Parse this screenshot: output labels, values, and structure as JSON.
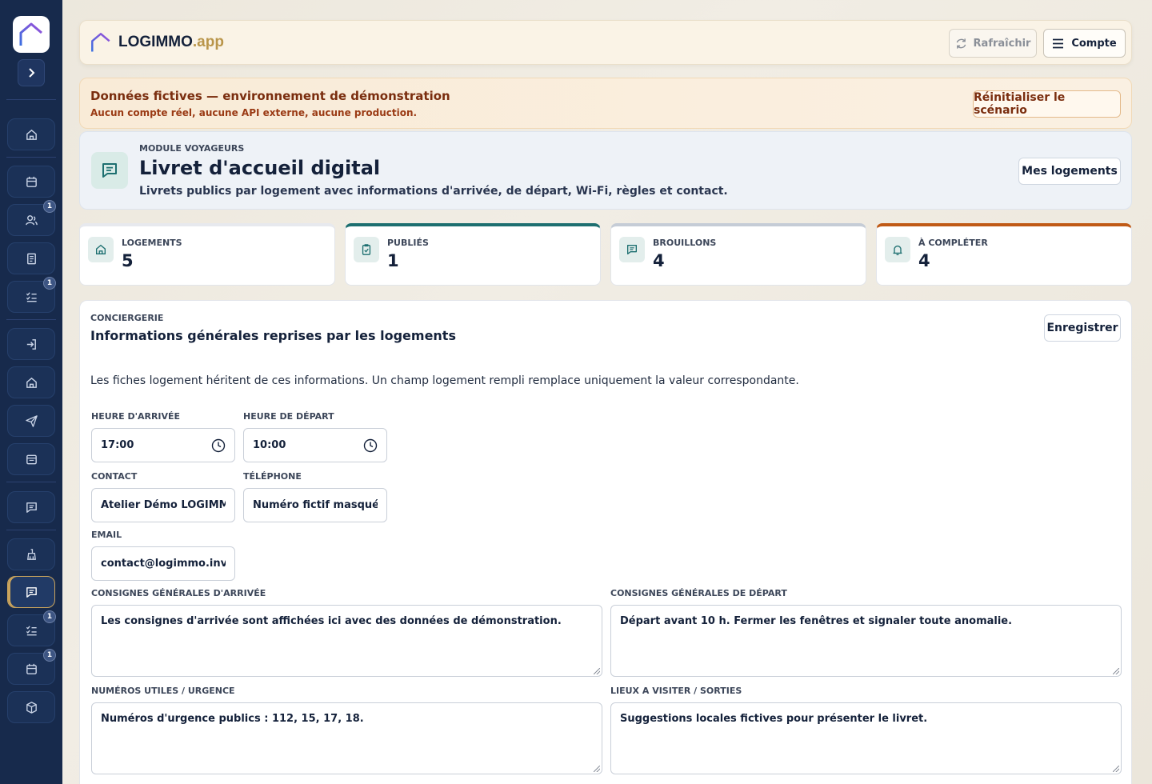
{
  "brand": {
    "name": "LOGIMMO",
    "tld": ".app"
  },
  "topbar": {
    "refresh_label": "Rafraîchir",
    "account_label": "Compte"
  },
  "demo": {
    "title": "Données fictives — environnement de démonstration",
    "subtitle": "Aucun compte réel, aucune API externe, aucune production.",
    "reset_label": "Réinitialiser le scénario"
  },
  "module": {
    "eyebrow": "MODULE VOYAGEURS",
    "title": "Livret d'accueil digital",
    "subtitle": "Livrets publics par logement avec informations d'arrivée, de départ, Wi-Fi, règles et contact.",
    "button_label": "Mes logements"
  },
  "stats": [
    {
      "label": "LOGEMENTS",
      "value": "5",
      "icon": "home-icon"
    },
    {
      "label": "PUBLIÉS",
      "value": "1",
      "icon": "clipboard-check-icon"
    },
    {
      "label": "BROUILLONS",
      "value": "4",
      "icon": "message-icon"
    },
    {
      "label": "À COMPLÉTER",
      "value": "4",
      "icon": "bell-icon"
    }
  ],
  "sidebar": {
    "badges": {
      "users": "1",
      "tasks": "1",
      "tasks2": "1",
      "calendar2": "1"
    },
    "items": [
      "home-icon",
      "calendar-icon",
      "users-icon",
      "document-icon",
      "checklist-icon",
      "login-icon",
      "home-icon",
      "send-icon",
      "inbox-icon",
      "message-icon",
      "cleaning-icon",
      "message-icon",
      "checklist-icon",
      "calendar-icon",
      "box-icon"
    ]
  },
  "form": {
    "eyebrow": "CONCIERGERIE",
    "title": "Informations générales reprises par les logements",
    "save_label": "Enregistrer",
    "description": "Les fiches logement héritent de ces informations. Un champ logement rempli remplace uniquement la valeur correspondante.",
    "arrival_time": {
      "label": "HEURE D'ARRIVÉE",
      "value": "17:00"
    },
    "departure_time": {
      "label": "HEURE DE DÉPART",
      "value": "10:00"
    },
    "contact": {
      "label": "CONTACT",
      "value": "Atelier Démo LOGIMMO"
    },
    "phone": {
      "label": "TÉLÉPHONE",
      "value": "Numéro fictif masqué"
    },
    "email": {
      "label": "EMAIL",
      "value": "contact@logimmo.invalid"
    },
    "arrival_instructions": {
      "label": "CONSIGNES GÉNÉRALES D'ARRIVÉE",
      "value": "Les consignes d'arrivée sont affichées ici avec des données de démonstration."
    },
    "departure_instructions": {
      "label": "CONSIGNES GÉNÉRALES DE DÉPART",
      "value": "Départ avant 10 h. Fermer les fenêtres et signaler toute anomalie."
    },
    "emergency_numbers": {
      "label": "NUMÉROS UTILES / URGENCE",
      "value": "Numéros d'urgence publics : 112, 15, 17, 18."
    },
    "places_to_visit": {
      "label": "LIEUX A VISITER / SORTIES",
      "value": "Suggestions locales fictives pour présenter le livret."
    }
  }
}
